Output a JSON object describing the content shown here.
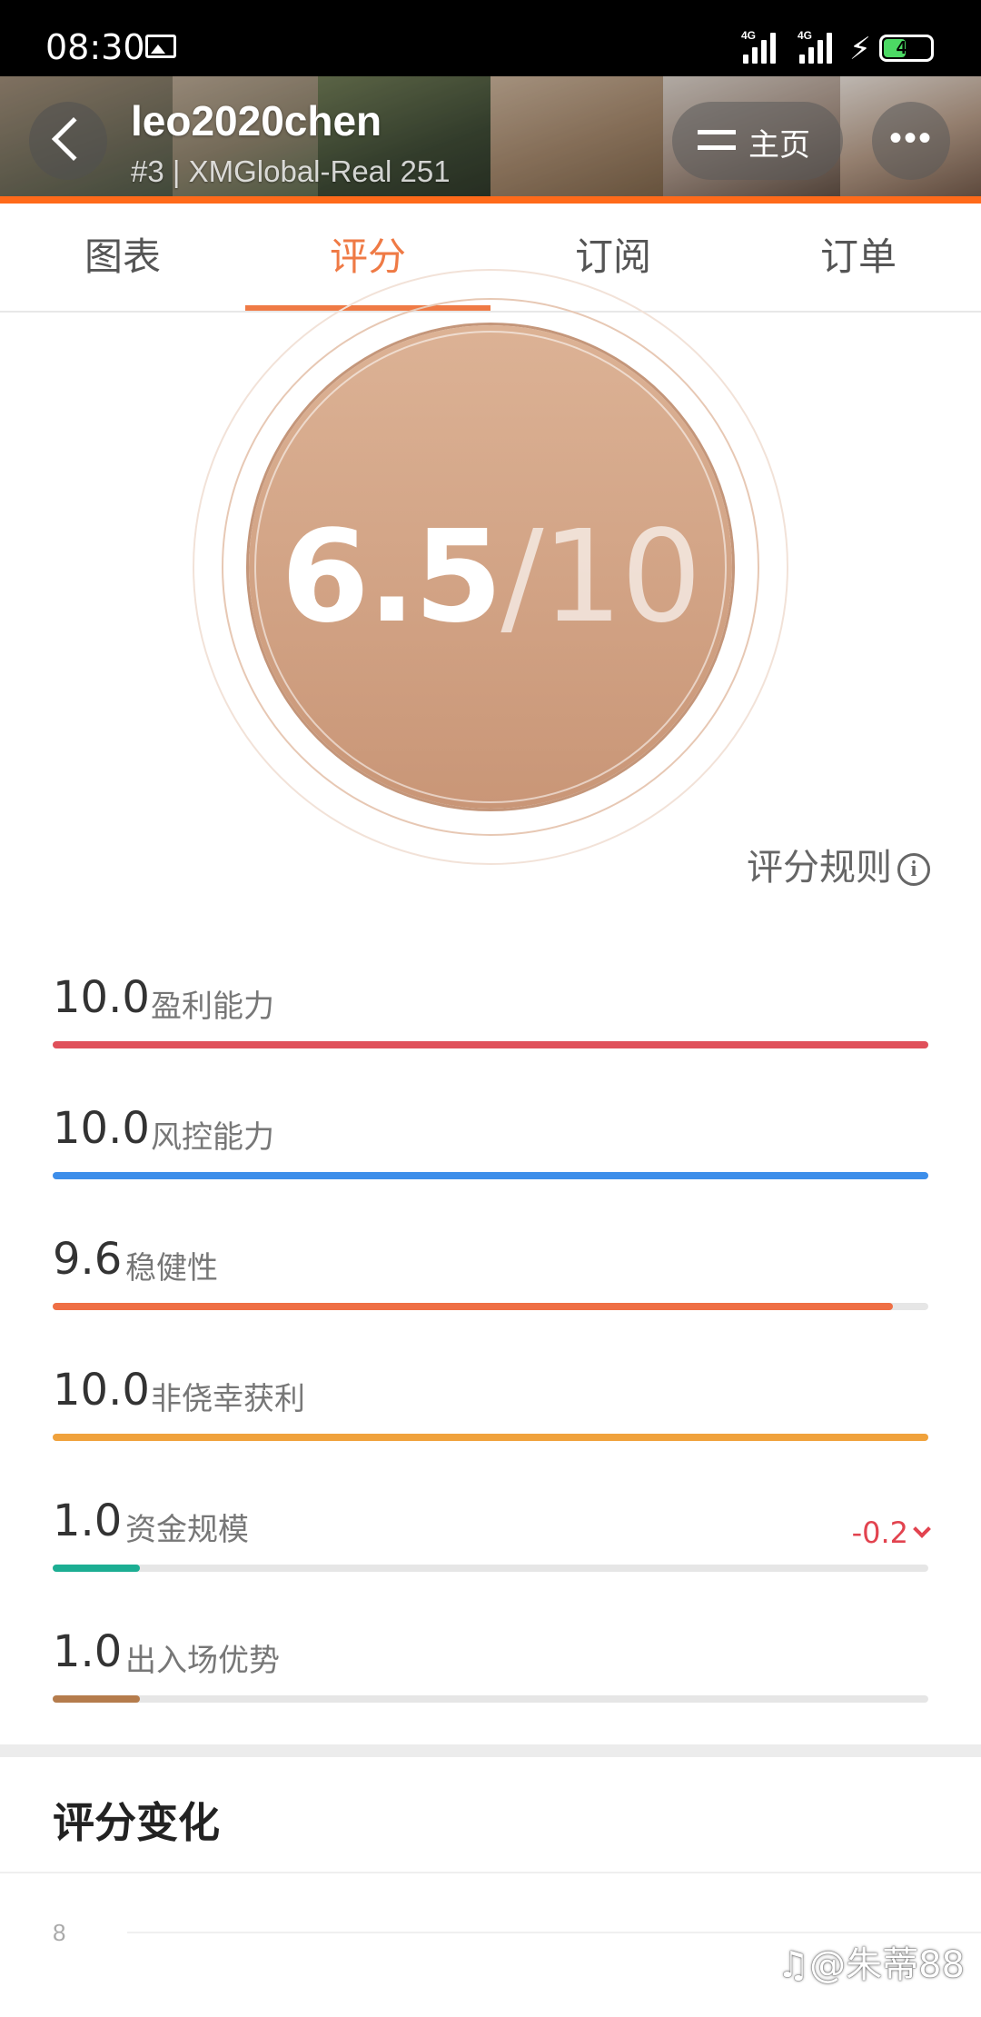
{
  "status_bar": {
    "time": "08:30",
    "network_1": "4G",
    "network_2": "4G",
    "battery": "45"
  },
  "header": {
    "user_name": "leo2020chen",
    "subtitle": "#3 | XMGlobal-Real 251",
    "home_label": "主页",
    "more_label": "•••",
    "accent_color": "#ff7a1a"
  },
  "tabs": [
    {
      "label": "图表",
      "active": false
    },
    {
      "label": "评分",
      "active": true
    },
    {
      "label": "订阅",
      "active": false
    },
    {
      "label": "订单",
      "active": false
    }
  ],
  "score": {
    "value": "6.5",
    "denominator": "/10"
  },
  "rules_link": "评分规则",
  "metrics": [
    {
      "value": "10.0",
      "name": "盈利能力",
      "fraction": 1.0,
      "color": "#e0505a"
    },
    {
      "value": "10.0",
      "name": "风控能力",
      "fraction": 1.0,
      "color": "#3d8eea"
    },
    {
      "value": "9.6",
      "name": "稳健性",
      "fraction": 0.96,
      "color": "#ef6f45"
    },
    {
      "value": "10.0",
      "name": "非侥幸获利",
      "fraction": 1.0,
      "color": "#f0a23c"
    },
    {
      "value": "1.0",
      "name": "资金规模",
      "fraction": 0.1,
      "color": "#1cae93",
      "change": "-0.2"
    },
    {
      "value": "1.0",
      "name": "出入场优势",
      "fraction": 0.1,
      "color": "#b57c4c"
    }
  ],
  "section": {
    "title": "评分变化",
    "axis_label": "8"
  },
  "watermark": "♫@朱蒂88"
}
